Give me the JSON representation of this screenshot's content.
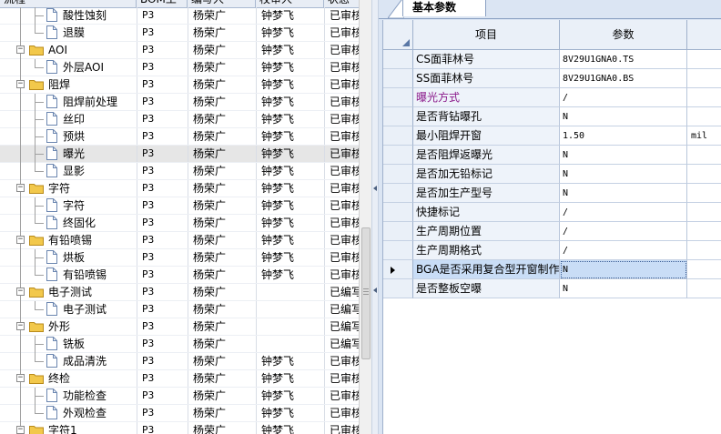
{
  "left_grid": {
    "headers": [
      "流程",
      "BOM工",
      "编写人",
      "校审人",
      "状态"
    ],
    "rows": [
      {
        "level": 2,
        "kind": "leaf",
        "label": "酸性蚀刻",
        "bom": "P3",
        "author": "杨荣广",
        "reviewer": "钟梦飞",
        "status": "已审核"
      },
      {
        "level": 2,
        "kind": "leaf",
        "label": "退膜",
        "bom": "P3",
        "author": "杨荣广",
        "reviewer": "钟梦飞",
        "status": "已审核"
      },
      {
        "level": 1,
        "kind": "folder",
        "label": "AOI",
        "bom": "P3",
        "author": "杨荣广",
        "reviewer": "钟梦飞",
        "status": "已审核"
      },
      {
        "level": 2,
        "kind": "leaf",
        "label": "外层AOI",
        "bom": "P3",
        "author": "杨荣广",
        "reviewer": "钟梦飞",
        "status": "已审核"
      },
      {
        "level": 1,
        "kind": "folder",
        "label": "阻焊",
        "bom": "P3",
        "author": "杨荣广",
        "reviewer": "钟梦飞",
        "status": "已审核"
      },
      {
        "level": 2,
        "kind": "leaf",
        "label": "阻焊前处理",
        "bom": "P3",
        "author": "杨荣广",
        "reviewer": "钟梦飞",
        "status": "已审核"
      },
      {
        "level": 2,
        "kind": "leaf",
        "label": "丝印",
        "bom": "P3",
        "author": "杨荣广",
        "reviewer": "钟梦飞",
        "status": "已审核"
      },
      {
        "level": 2,
        "kind": "leaf",
        "label": "预烘",
        "bom": "P3",
        "author": "杨荣广",
        "reviewer": "钟梦飞",
        "status": "已审核"
      },
      {
        "level": 2,
        "kind": "leaf",
        "label": "曝光",
        "bom": "P3",
        "author": "杨荣广",
        "reviewer": "钟梦飞",
        "status": "已审核",
        "selected": true
      },
      {
        "level": 2,
        "kind": "leaf",
        "label": "显影",
        "bom": "P3",
        "author": "杨荣广",
        "reviewer": "钟梦飞",
        "status": "已审核"
      },
      {
        "level": 1,
        "kind": "folder",
        "label": "字符",
        "bom": "P3",
        "author": "杨荣广",
        "reviewer": "钟梦飞",
        "status": "已审核"
      },
      {
        "level": 2,
        "kind": "leaf",
        "label": "字符",
        "bom": "P3",
        "author": "杨荣广",
        "reviewer": "钟梦飞",
        "status": "已审核"
      },
      {
        "level": 2,
        "kind": "leaf",
        "label": "终固化",
        "bom": "P3",
        "author": "杨荣广",
        "reviewer": "钟梦飞",
        "status": "已审核"
      },
      {
        "level": 1,
        "kind": "folder",
        "label": "有铅喷锡",
        "bom": "P3",
        "author": "杨荣广",
        "reviewer": "钟梦飞",
        "status": "已审核"
      },
      {
        "level": 2,
        "kind": "leaf",
        "label": "烘板",
        "bom": "P3",
        "author": "杨荣广",
        "reviewer": "钟梦飞",
        "status": "已审核"
      },
      {
        "level": 2,
        "kind": "leaf",
        "label": "有铅喷锡",
        "bom": "P3",
        "author": "杨荣广",
        "reviewer": "钟梦飞",
        "status": "已审核"
      },
      {
        "level": 1,
        "kind": "folder",
        "label": "电子测试",
        "bom": "P3",
        "author": "杨荣广",
        "reviewer": "",
        "status": "已编写"
      },
      {
        "level": 2,
        "kind": "leaf",
        "label": "电子测试",
        "bom": "P3",
        "author": "杨荣广",
        "reviewer": "",
        "status": "已编写"
      },
      {
        "level": 1,
        "kind": "folder",
        "label": "外形",
        "bom": "P3",
        "author": "杨荣广",
        "reviewer": "",
        "status": "已编写"
      },
      {
        "level": 2,
        "kind": "leaf",
        "label": "铣板",
        "bom": "P3",
        "author": "杨荣广",
        "reviewer": "",
        "status": "已编写"
      },
      {
        "level": 2,
        "kind": "leaf",
        "label": "成品清洗",
        "bom": "P3",
        "author": "杨荣广",
        "reviewer": "钟梦飞",
        "status": "已审核"
      },
      {
        "level": 1,
        "kind": "folder",
        "label": "终检",
        "bom": "P3",
        "author": "杨荣广",
        "reviewer": "钟梦飞",
        "status": "已审核"
      },
      {
        "level": 2,
        "kind": "leaf",
        "label": "功能检查",
        "bom": "P3",
        "author": "杨荣广",
        "reviewer": "钟梦飞",
        "status": "已审核"
      },
      {
        "level": 2,
        "kind": "leaf",
        "label": "外观检查",
        "bom": "P3",
        "author": "杨荣广",
        "reviewer": "钟梦飞",
        "status": "已审核"
      },
      {
        "level": 1,
        "kind": "folder",
        "label": "字符1",
        "bom": "P3",
        "author": "杨荣广",
        "reviewer": "钟梦飞",
        "status": "已审核"
      }
    ]
  },
  "right_panel": {
    "tab_label": "基本参数",
    "columns": [
      "项目",
      "参数"
    ],
    "params": [
      {
        "name": "CS面菲林号",
        "value": "8V29U1GNA0.TS",
        "unit": ""
      },
      {
        "name": "SS面菲林号",
        "value": "8V29U1GNA0.BS",
        "unit": ""
      },
      {
        "name": "曝光方式",
        "value": "/",
        "unit": "",
        "highlight": "#8b1a8b"
      },
      {
        "name": "是否背钻曝孔",
        "value": "N",
        "unit": ""
      },
      {
        "name": "最小阻焊开窗",
        "value": "1.50",
        "unit": "mil"
      },
      {
        "name": "是否阻焊返曝光",
        "value": "N",
        "unit": ""
      },
      {
        "name": "是否加无铅标记",
        "value": "N",
        "unit": ""
      },
      {
        "name": "是否加生产型号",
        "value": "N",
        "unit": ""
      },
      {
        "name": "快捷标记",
        "value": "/",
        "unit": ""
      },
      {
        "name": "生产周期位置",
        "value": "/",
        "unit": ""
      },
      {
        "name": "生产周期格式",
        "value": "/",
        "unit": ""
      },
      {
        "name": "BGA是否采用复合型开窗制作",
        "value": "N",
        "unit": "",
        "selected": true
      },
      {
        "name": "是否整板空曝",
        "value": "N",
        "unit": ""
      }
    ]
  },
  "colors": {
    "folder": "#f2c84b",
    "selected_row": "#c9ddf6",
    "header_bg": "#eaf0f8",
    "panel_bg": "#dbe5f3"
  }
}
